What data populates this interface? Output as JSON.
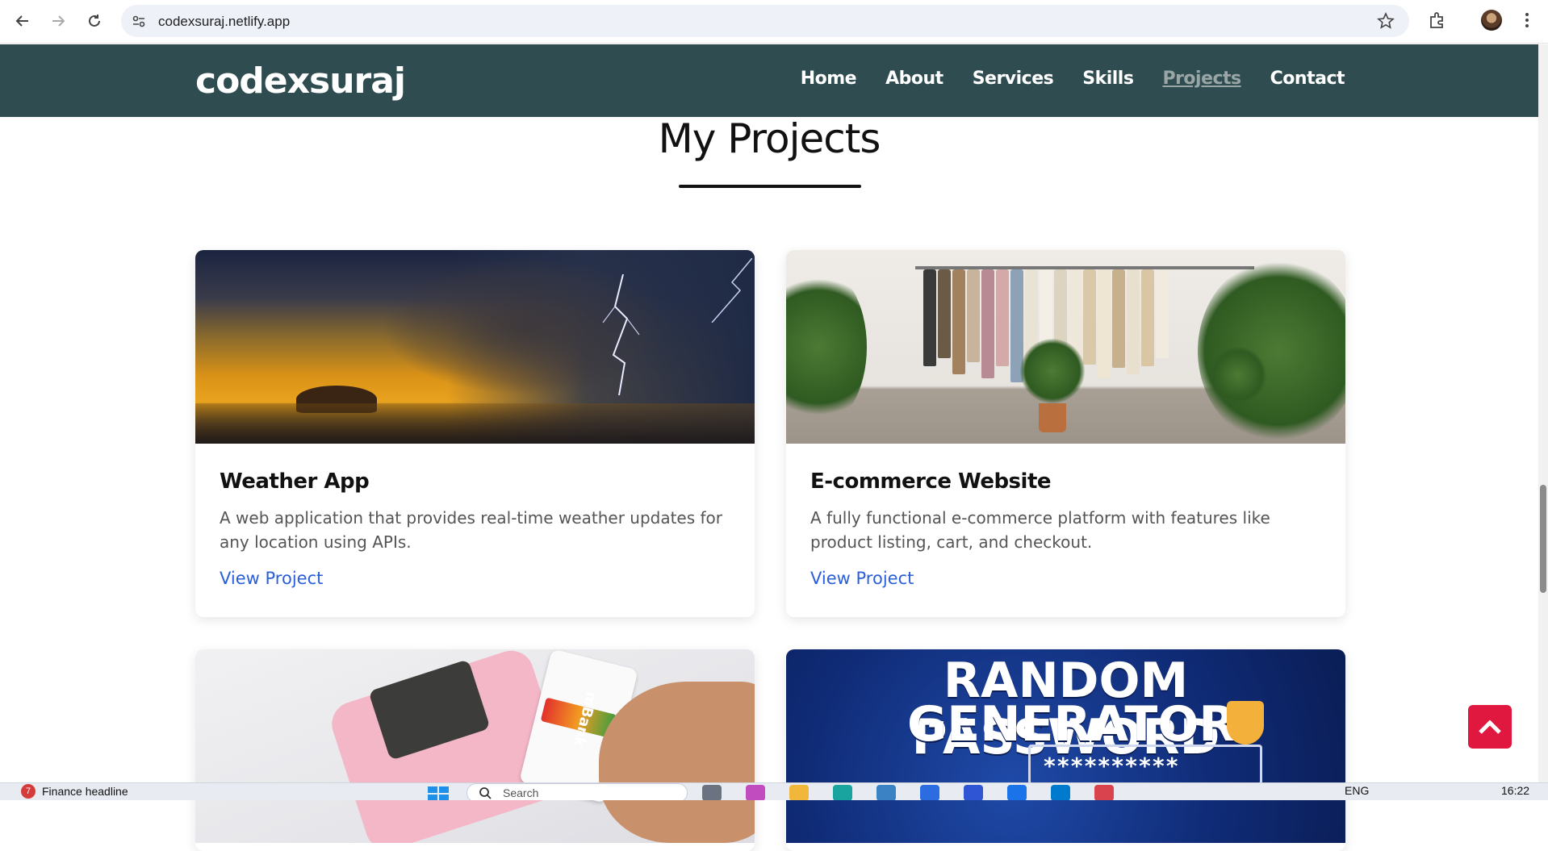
{
  "browser": {
    "url": "codexsuraj.netlify.app"
  },
  "site": {
    "logo": "codexsuraj",
    "nav": [
      {
        "label": "Home",
        "active": false
      },
      {
        "label": "About",
        "active": false
      },
      {
        "label": "Services",
        "active": false
      },
      {
        "label": "Skills",
        "active": false
      },
      {
        "label": "Projects",
        "active": true
      },
      {
        "label": "Contact",
        "active": false
      }
    ],
    "header_color": "#2f4d50",
    "accent_link_color": "#2b5fd9",
    "scroll_top_color": "#e0173f"
  },
  "section": {
    "title": "My Projects"
  },
  "projects": [
    {
      "title": "Weather App",
      "description": "A web application that provides real-time weather updates for any location using APIs.",
      "link": "View Project",
      "image_icon": "storm-landscape-image"
    },
    {
      "title": "E-commerce Website",
      "description": "A fully functional e-commerce platform with features like product listing, cart, and checkout.",
      "link": "View Project",
      "image_icon": "clothing-rack-image"
    },
    {
      "image_icon": "card-payment-terminal-image",
      "image_text": "mBank"
    },
    {
      "image_icon": "password-generator-image",
      "image_text_line1": "RANDOM PASSWORD",
      "image_text_line2": "GENERATOR",
      "image_text_stars": "**********"
    }
  ],
  "taskbar": {
    "widget_badge": "7",
    "widget_label": "Finance headline",
    "search_placeholder": "Search",
    "language": "ENG",
    "time": "16:22"
  }
}
